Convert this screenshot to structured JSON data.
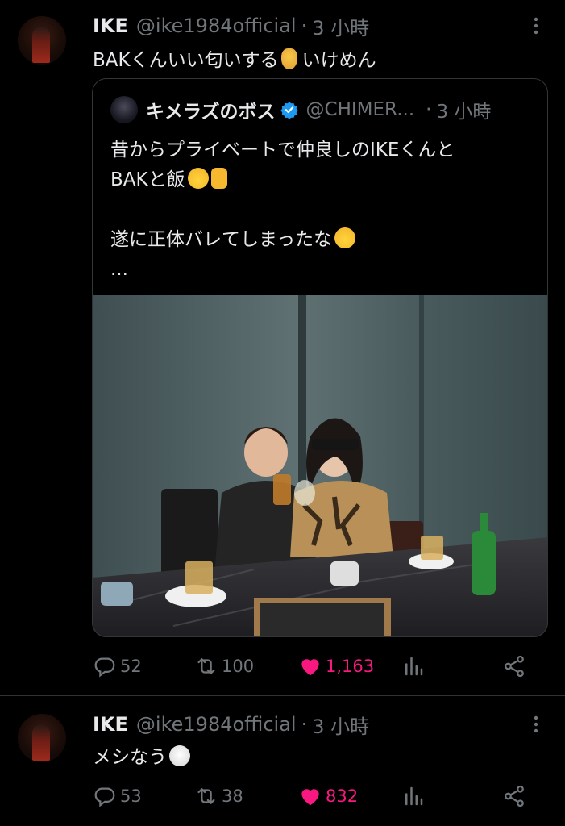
{
  "tweets": [
    {
      "name": "IKE",
      "handle": "@ike1984official",
      "dot": "·",
      "time": "3 小時",
      "text": "BAKくんいい匂いする",
      "text_after_emoji": "いけめん",
      "emoji": "nose-emoji",
      "quote": {
        "name": "キメラズのボス",
        "handle": "@CHIMER...",
        "dot": "·",
        "time": "3 小時",
        "lines": [
          "昔からプライベートで仲良しのIKEくんと",
          "BAKと飯",
          "",
          "遂に正体バレてしまったな",
          "..."
        ],
        "image_alt": "photo"
      },
      "stats": {
        "replies": "52",
        "retweets": "100",
        "likes": "1,163"
      }
    },
    {
      "name": "IKE",
      "handle": "@ike1984official",
      "dot": "·",
      "time": "3 小時",
      "text": "メシなう",
      "emoji": "rice-ball-emoji",
      "stats": {
        "replies": "53",
        "retweets": "38",
        "likes": "832"
      }
    }
  ],
  "colors": {
    "accent_like": "#f91880",
    "muted": "#71767b",
    "verified": "#1d9bf0"
  }
}
